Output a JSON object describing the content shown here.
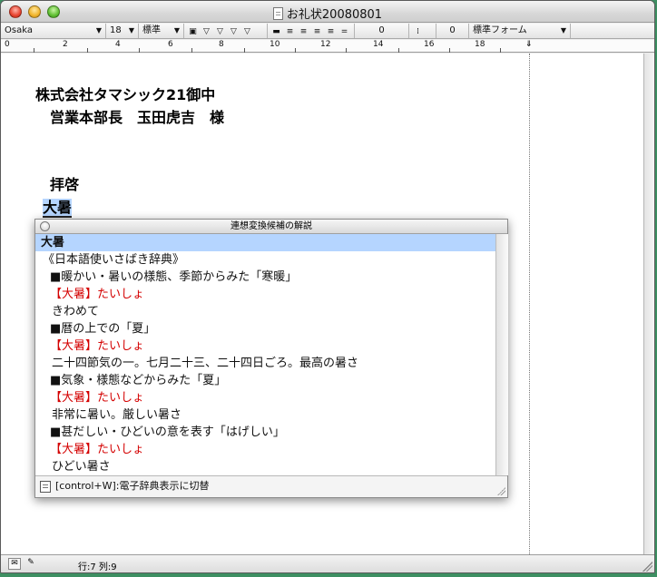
{
  "window": {
    "title": "お礼状20080801"
  },
  "toolbar": {
    "font": "Osaka",
    "size": "18",
    "style": "標準",
    "spacing_value": "0",
    "indent_value": "0",
    "form": "標準フォーム"
  },
  "ruler": {
    "labels": [
      "0",
      "2",
      "4",
      "6",
      "8",
      "10",
      "12",
      "14",
      "16",
      "18"
    ]
  },
  "document": {
    "lines": [
      "株式会社タマシック21御中",
      "　営業本部長　玉田虎吉　様",
      "　拝啓",
      "大暑"
    ]
  },
  "popup": {
    "title": "連想変換候補の解説",
    "entries": [
      "大暑",
      "《日本語使いさばき辞典》",
      "■暖かい・暑いの様態、季節からみた「寒暖」",
      "【大暑】たいしょ",
      "きわめて",
      "■暦の上での「夏」",
      "【大暑】たいしょ",
      "二十四節気の一。七月二十三、二十四日ごろ。最高の暑さ",
      "■気象・様態などからみた「夏」",
      "【大暑】たいしょ",
      "非常に暑い。厳しい暑さ",
      "■甚だしい・ひどいの意を表す「はげしい」",
      "【大暑】たいしょ",
      "ひどい暑さ"
    ],
    "footer": "[control+W]:電子辞典表示に切替"
  },
  "statusbar": {
    "position": "行:7  列:9"
  },
  "colors": {
    "selection": "#b5d5ff",
    "dictionary_red": "#d40000",
    "desktop": "#3d8f62"
  }
}
